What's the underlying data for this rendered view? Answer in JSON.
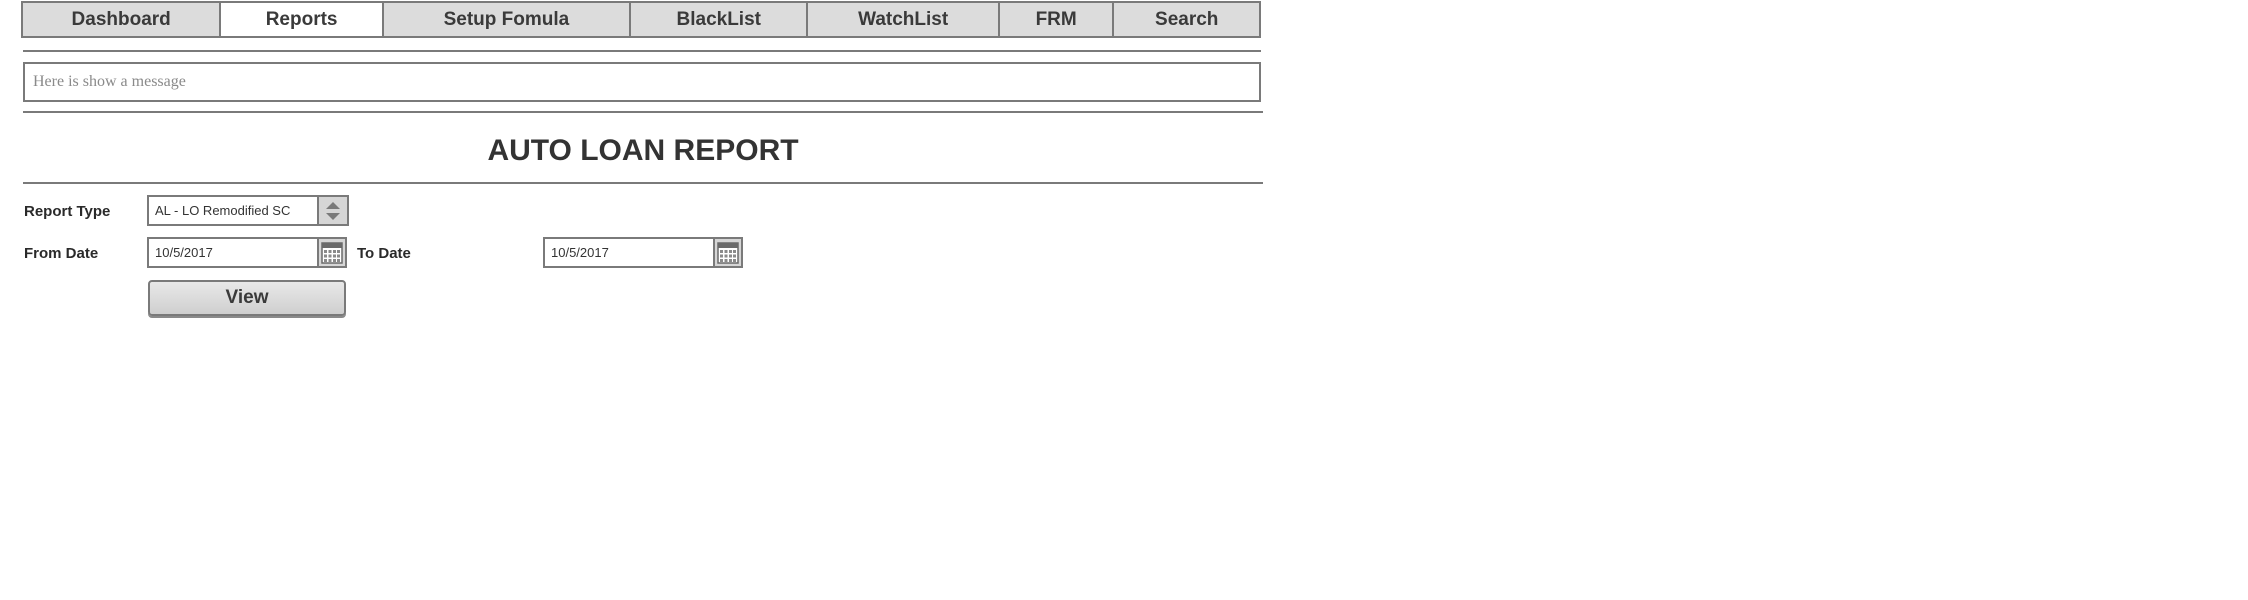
{
  "nav": {
    "tabs": [
      {
        "label": "Dashboard",
        "active": false
      },
      {
        "label": "Reports",
        "active": true
      },
      {
        "label": "Setup Fomula",
        "active": false
      },
      {
        "label": "BlackList",
        "active": false
      },
      {
        "label": "WatchList",
        "active": false
      },
      {
        "label": "FRM",
        "active": false
      },
      {
        "label": "Search",
        "active": false
      }
    ]
  },
  "message": {
    "placeholder": "Here is show a message"
  },
  "report": {
    "title": "AUTO LOAN REPORT",
    "report_type_label": "Report Type",
    "report_type_value": "AL - LO Remodified SC",
    "from_date_label": "From Date",
    "from_date_value": "10/5/2017",
    "to_date_label": "To Date",
    "to_date_value": "10/5/2017",
    "view_label": "View"
  },
  "icons": {
    "select": "up-down-arrows-icon",
    "date": "calendar-icon"
  },
  "colors": {
    "border": "#7a7a7a",
    "tab_bg": "#dcdcdc",
    "tab_active_bg": "#ffffff",
    "text": "#333333"
  }
}
